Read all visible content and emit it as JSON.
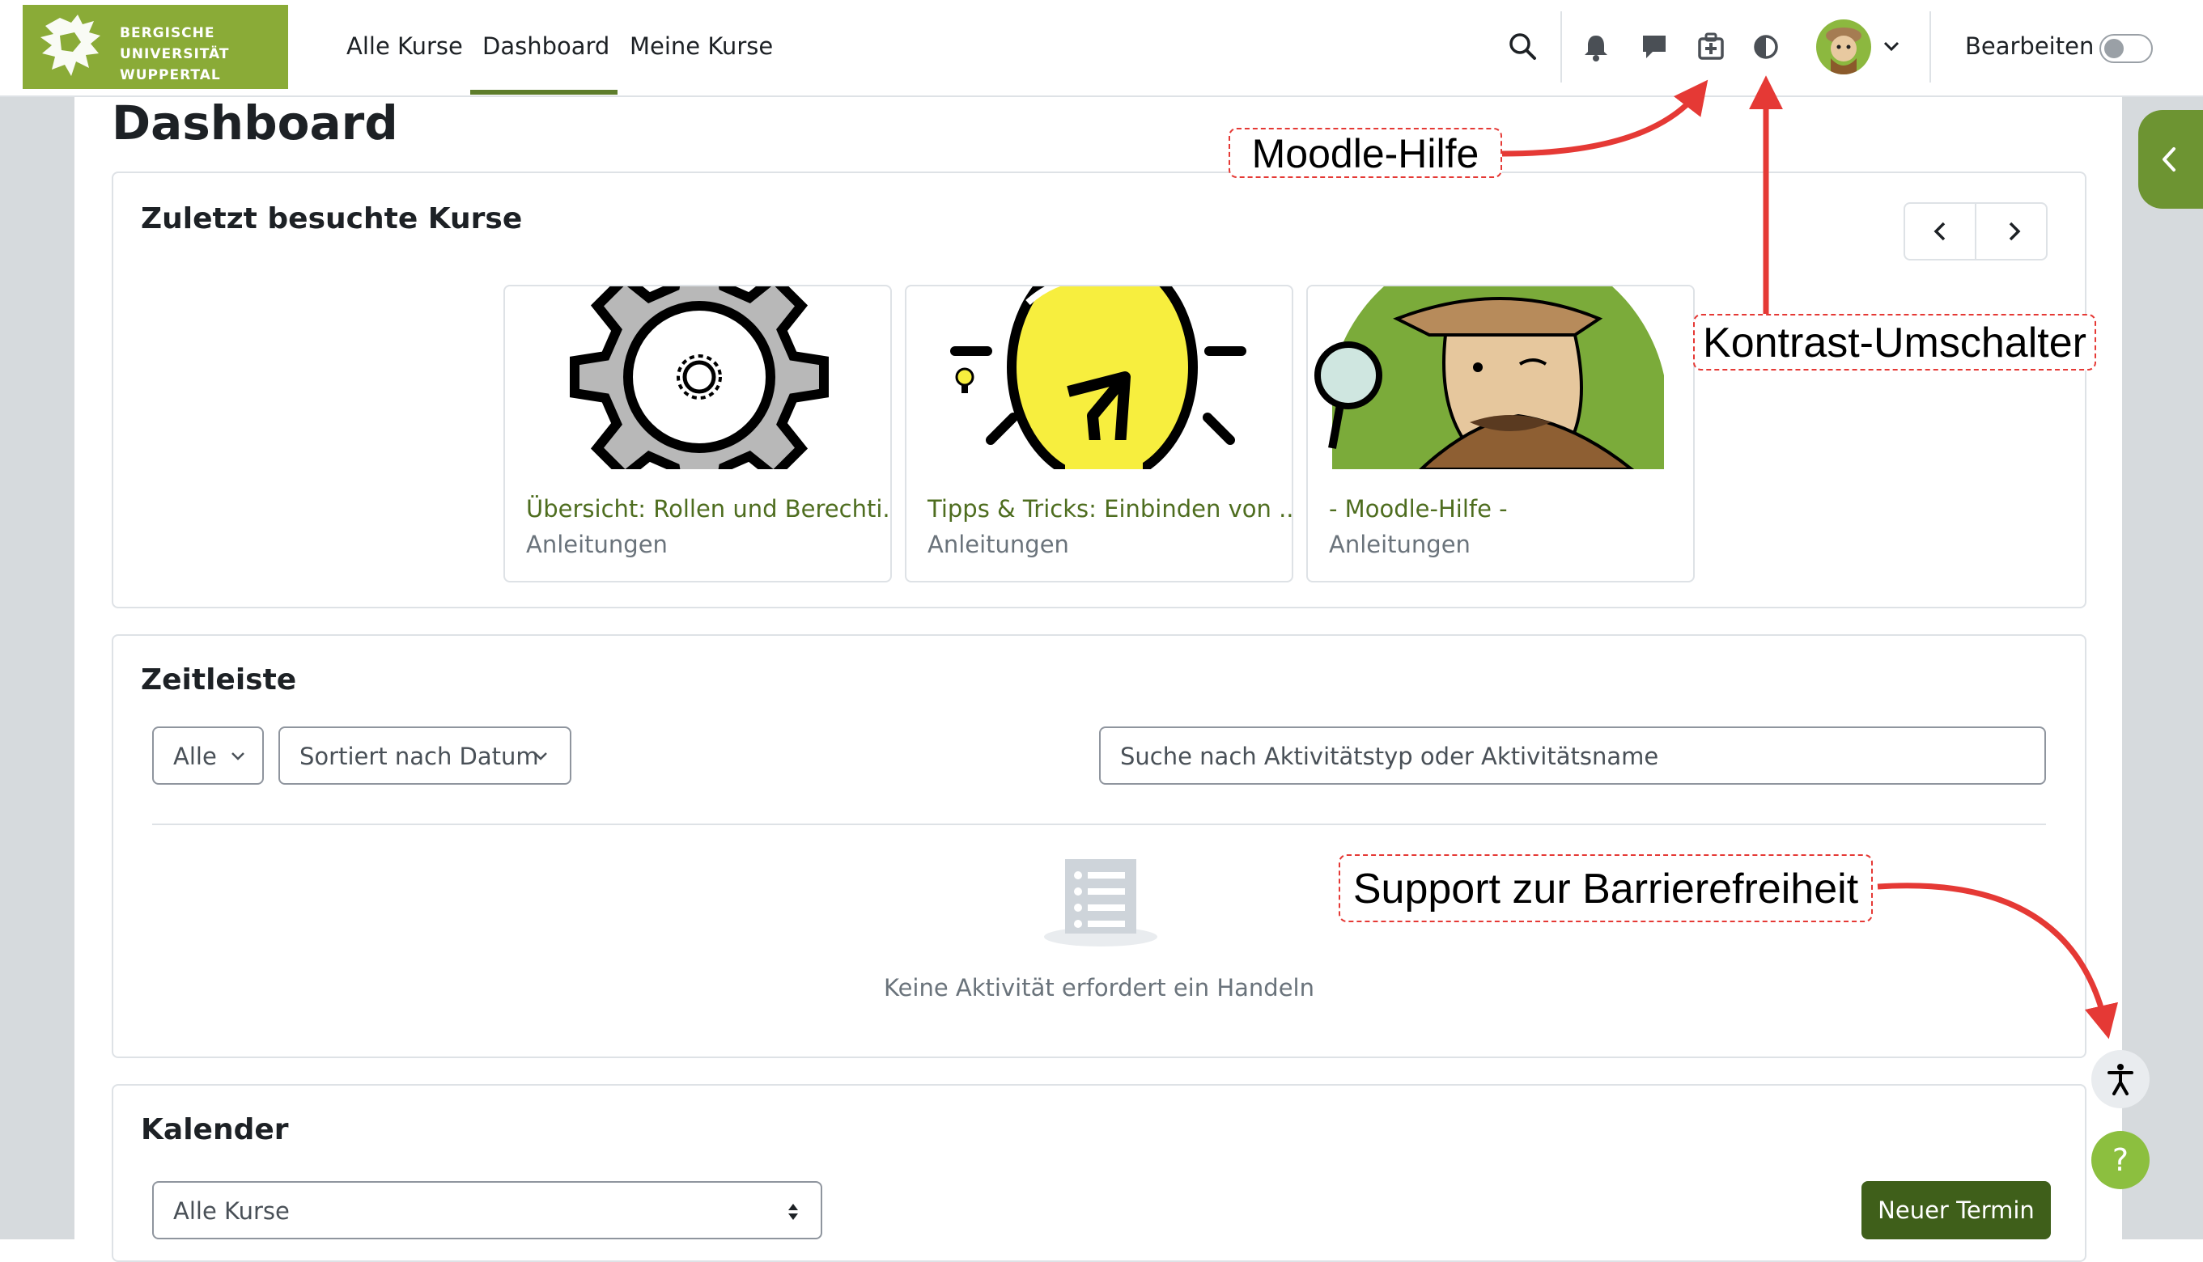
{
  "logo": {
    "lines": [
      "BERGISCHE",
      "UNIVERSITÄT",
      "WUPPERTAL"
    ]
  },
  "nav": {
    "links": [
      "Alle Kurse",
      "Dashboard",
      "Meine Kurse"
    ],
    "active": "Dashboard",
    "edit_label": "Bearbeiten",
    "icons": [
      "search-icon",
      "bell-icon",
      "message-icon",
      "moodle-help-icon",
      "contrast-icon",
      "avatar",
      "chevron-down-icon"
    ]
  },
  "page_title": "Dashboard",
  "recent_courses": {
    "title": "Zuletzt besuchte Kurse",
    "courses": [
      {
        "name": "Übersicht: Rollen und Berechti...",
        "category": "Anleitungen"
      },
      {
        "name": "Tipps & Tricks: Einbinden von ...",
        "category": "Anleitungen"
      },
      {
        "name": "- Moodle-Hilfe -",
        "category": "Anleitungen"
      }
    ]
  },
  "timeline": {
    "title": "Zeitleiste",
    "filter": "Alle",
    "sort": "Sortiert nach Datum",
    "search_placeholder": "Suche nach Aktivitätstyp oder Aktivitätsname",
    "empty_text": "Keine Aktivität erfordert ein Handeln"
  },
  "calendar": {
    "title": "Kalender",
    "course_select": "Alle Kurse",
    "new_event_button": "Neuer Termin"
  },
  "annotations": {
    "moodle_help": "Moodle-Hilfe",
    "contrast_switch": "Kontrast-Umschalter",
    "accessibility_support": "Support zur Barrierefreiheit"
  },
  "help_button": "?",
  "colors": {
    "brand_green": "#8aab37",
    "primary_button": "#3f5f1a",
    "link_green": "#4e6d1f",
    "annotation_red": "#e53935"
  }
}
